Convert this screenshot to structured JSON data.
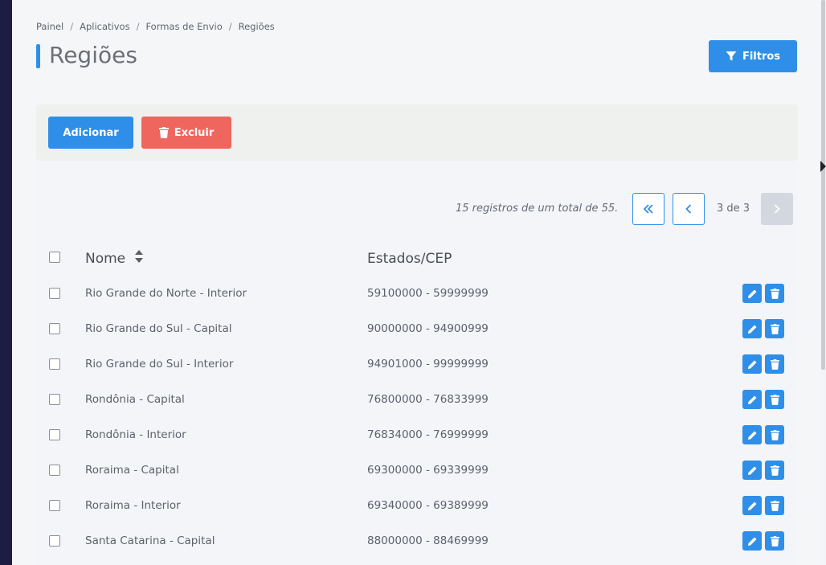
{
  "breadcrumb": [
    {
      "label": "Painel"
    },
    {
      "label": "Aplicativos"
    },
    {
      "label": "Formas de Envio"
    },
    {
      "label": "Regiões"
    }
  ],
  "page_title": "Regiões",
  "buttons": {
    "filtros": "Filtros",
    "adicionar": "Adicionar",
    "excluir": "Excluir"
  },
  "pagination": {
    "records_text": "15 registros de um total de 55.",
    "page_label": "3 de 3"
  },
  "table": {
    "columns": [
      "Nome",
      "Estados/CEP"
    ],
    "rows": [
      {
        "nome": "Rio Grande do Norte - Interior",
        "cep": "59100000 - 59999999"
      },
      {
        "nome": "Rio Grande do Sul - Capital",
        "cep": "90000000 - 94900999"
      },
      {
        "nome": "Rio Grande do Sul - Interior",
        "cep": "94901000 - 99999999"
      },
      {
        "nome": "Rondônia - Capital",
        "cep": "76800000 - 76833999"
      },
      {
        "nome": "Rondônia - Interior",
        "cep": "76834000 - 76999999"
      },
      {
        "nome": "Roraima - Capital",
        "cep": "69300000 - 69339999"
      },
      {
        "nome": "Roraima - Interior",
        "cep": "69340000 - 69389999"
      },
      {
        "nome": "Santa Catarina - Capital",
        "cep": "88000000 - 88469999"
      }
    ]
  },
  "icons": {
    "filter": "filter-icon",
    "trash": "trash-icon",
    "edit": "pencil-icon",
    "first_page": "double-chevron-left-icon",
    "prev_page": "chevron-left-icon",
    "next_page": "chevron-right-icon",
    "sort": "sort-icon"
  },
  "colors": {
    "primary": "#2f8fe8",
    "danger": "#ef665e",
    "sidebar": "#1c1c44",
    "disabled": "#d3d7df"
  }
}
